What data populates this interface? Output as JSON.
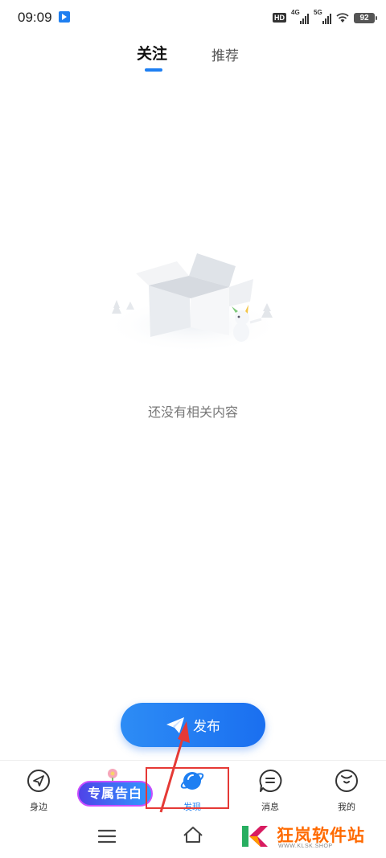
{
  "status_bar": {
    "time": "09:09",
    "hd_label": "HD",
    "network_1": "4G",
    "network_2": "5G",
    "battery": "92"
  },
  "tabs": [
    {
      "label": "关注",
      "active": true
    },
    {
      "label": "推荐",
      "active": false
    }
  ],
  "empty_state": {
    "message": "还没有相关内容",
    "illustration": "empty-box-illustration"
  },
  "publish_button": {
    "label": "发布",
    "icon": "paper-plane-icon",
    "color": "#1e7ff2"
  },
  "bottom_nav": {
    "items": [
      {
        "label": "身边",
        "icon": "location-arrow-icon"
      },
      {
        "label": "发现",
        "icon": "planet-icon",
        "active": true
      },
      {
        "label": "消息",
        "icon": "chat-bubble-icon"
      },
      {
        "label": "我的",
        "icon": "profile-face-icon"
      }
    ],
    "promo_badge": "专属告白"
  },
  "watermark": {
    "text": "狂岚软件站",
    "url": "WWW.KLSK.SHOP"
  },
  "colors": {
    "accent": "#1e7ff2",
    "annotation": "#e53935"
  }
}
